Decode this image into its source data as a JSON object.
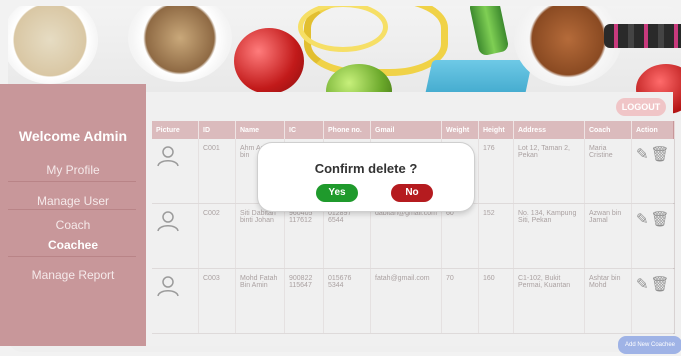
{
  "sidebar": {
    "welcome": "Welcome Admin",
    "items": [
      {
        "label": "My Profile"
      },
      {
        "label": "Manage User"
      },
      {
        "label": "Coach"
      },
      {
        "label": "Coachee"
      },
      {
        "label": "Manage Report"
      }
    ]
  },
  "header": {
    "logout": "LOGOUT"
  },
  "table": {
    "columns": [
      "Picture",
      "ID",
      "Name",
      "IC",
      "Phone no.",
      "Gmail",
      "Weight",
      "Height",
      "Address",
      "Coach",
      "Action"
    ],
    "rows": [
      {
        "id": "C001",
        "name": "Ahm Azw bin",
        "ic": "",
        "phone": "",
        "gmail": "",
        "weight": "",
        "height": "176",
        "address": "Lot 12, Taman 2, Pekan",
        "coach": "Maria Cristine"
      },
      {
        "id": "C002",
        "name": "Siti Dabitah binti Johan",
        "ic": "960405 117612",
        "phone": "012897 6544",
        "gmail": "dabitah@gmail.com",
        "weight": "60",
        "height": "152",
        "address": "No. 134, Kampung Siti, Pekan",
        "coach": "Azwan bin Jamal"
      },
      {
        "id": "C003",
        "name": "Mohd Fatah Bin Amin",
        "ic": "900822 115647",
        "phone": "015676 5344",
        "gmail": "fatah@gmail.com",
        "weight": "70",
        "height": "160",
        "address": "C1-102, Bukit Permai, Kuantan",
        "coach": "Ashtar bin Mohd"
      }
    ]
  },
  "modal": {
    "title": "Confirm delete ?",
    "yes": "Yes",
    "no": "No"
  },
  "footer": {
    "add_button": "Add New Coachee"
  },
  "colors": {
    "sidebar": "#c8979a",
    "yes": "#1f9a2c",
    "no": "#b51b1f",
    "logout": "#e9a7a9"
  },
  "icons": {
    "avatar": "person-outline-icon",
    "edit": "edit-icon",
    "delete": "trash-icon"
  }
}
